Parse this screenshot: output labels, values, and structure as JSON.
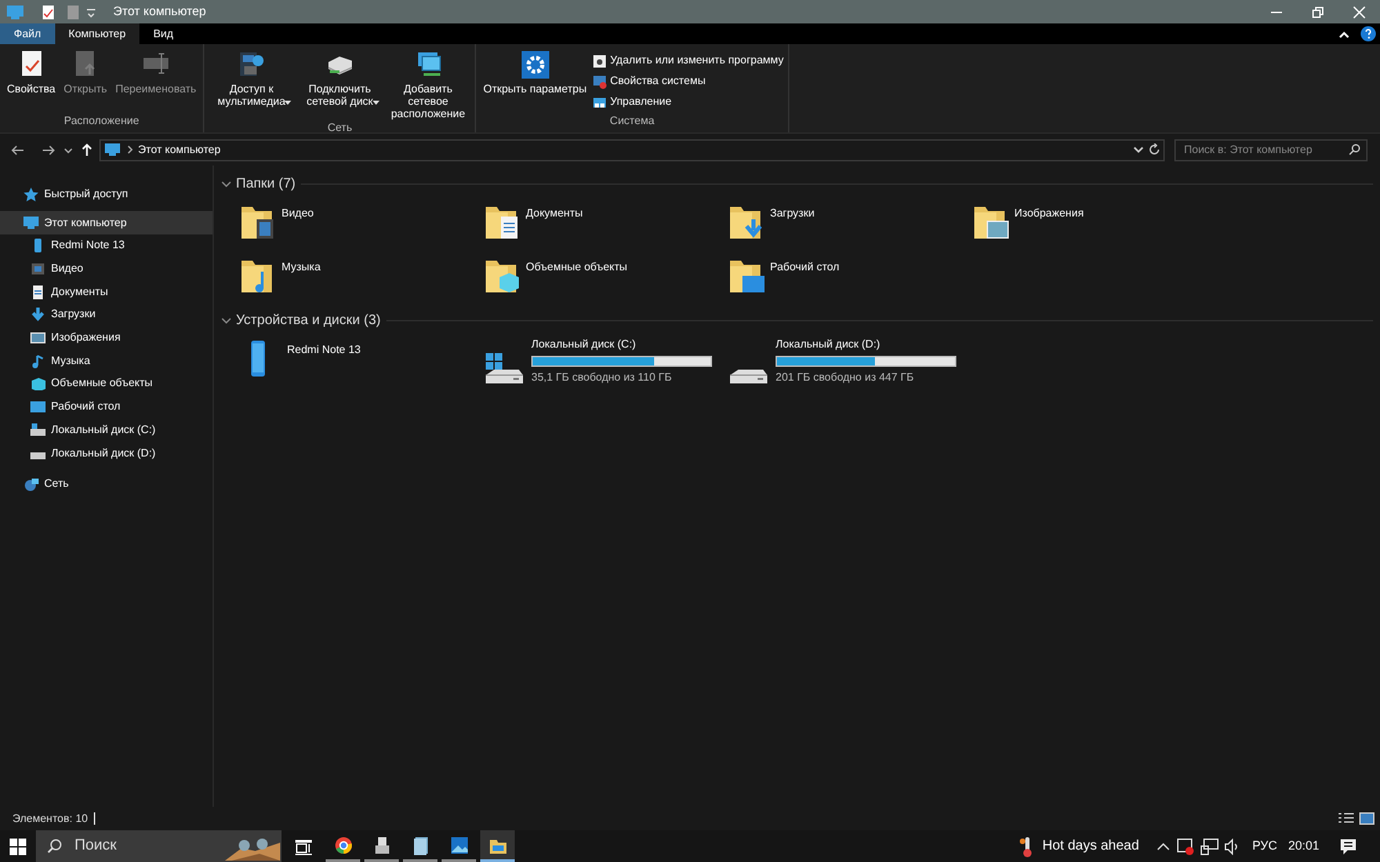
{
  "window": {
    "title": "Этот компьютер"
  },
  "ribbon_tabs": [
    {
      "label": "Файл",
      "kind": "file",
      "selected": false
    },
    {
      "label": "Компьютер",
      "kind": "tab",
      "selected": true
    },
    {
      "label": "Вид",
      "kind": "tab",
      "selected": false
    }
  ],
  "ribbon_groups": [
    {
      "label": "Расположение",
      "buttons": [
        {
          "label": "Свойства",
          "kind": "large",
          "disabled": false
        },
        {
          "label": "Открыть",
          "kind": "large",
          "disabled": true
        },
        {
          "label": "Переименовать",
          "kind": "large",
          "disabled": true
        }
      ]
    },
    {
      "label": "Сеть",
      "buttons": [
        {
          "label": "Доступ к мультимедиа",
          "kind": "large",
          "disabled": false,
          "dropdown": true
        },
        {
          "label": "Подключить сетевой диск",
          "kind": "large",
          "disabled": false,
          "dropdown": true
        },
        {
          "label": "Добавить сетевое расположение",
          "kind": "large",
          "disabled": false
        }
      ]
    },
    {
      "label": "Система",
      "buttons": [
        {
          "label": "Открыть параметры",
          "kind": "large",
          "disabled": false
        },
        {
          "label": "Удалить или изменить программу",
          "kind": "small",
          "disabled": false
        },
        {
          "label": "Свойства системы",
          "kind": "small",
          "disabled": false
        },
        {
          "label": "Управление",
          "kind": "small",
          "disabled": false
        }
      ]
    }
  ],
  "address_bar": {
    "path": "Этот компьютер"
  },
  "search": {
    "placeholder": "Поиск в: Этот компьютер"
  },
  "sidebar": {
    "items": [
      {
        "label": "Быстрый доступ",
        "selected": false
      },
      {
        "label": "Этот компьютер",
        "selected": true,
        "children": [
          {
            "label": "Redmi Note 13",
            "selected": false
          },
          {
            "label": "Видео",
            "selected": false
          },
          {
            "label": "Документы",
            "selected": false
          },
          {
            "label": "Загрузки",
            "selected": false
          },
          {
            "label": "Изображения",
            "selected": false
          },
          {
            "label": "Музыка",
            "selected": false
          },
          {
            "label": "Объемные объекты",
            "selected": false
          },
          {
            "label": "Рабочий стол",
            "selected": false
          },
          {
            "label": "Локальный диск (C:)",
            "selected": false
          },
          {
            "label": "Локальный диск (D:)",
            "selected": false
          }
        ]
      },
      {
        "label": "Сеть",
        "selected": false
      }
    ]
  },
  "folders": {
    "title": "Папки (7)",
    "items": [
      {
        "name": "Видео"
      },
      {
        "name": "Документы"
      },
      {
        "name": "Загрузки"
      },
      {
        "name": "Изображения"
      },
      {
        "name": "Музыка"
      },
      {
        "name": "Объемные объекты"
      },
      {
        "name": "Рабочий стол"
      }
    ]
  },
  "devices": {
    "title": "Устройства и диски (3)",
    "items": [
      {
        "kind": "phone",
        "name": "Redmi Note 13"
      },
      {
        "kind": "disk",
        "name": "Локальный диск (C:)",
        "level": 0.68,
        "free": "35,1 ГБ свободно из 110 ГБ",
        "system": true
      },
      {
        "kind": "disk",
        "name": "Локальный диск (D:)",
        "level": 0.55,
        "free": "201 ГБ свободно из 447 ГБ",
        "system": false
      }
    ]
  },
  "status_bar": {
    "items_count": "Элементов: 10"
  },
  "taskbar": {
    "search_placeholder": "Поиск",
    "weather": "Hot days ahead",
    "language": "РУС",
    "time": "20:01"
  }
}
